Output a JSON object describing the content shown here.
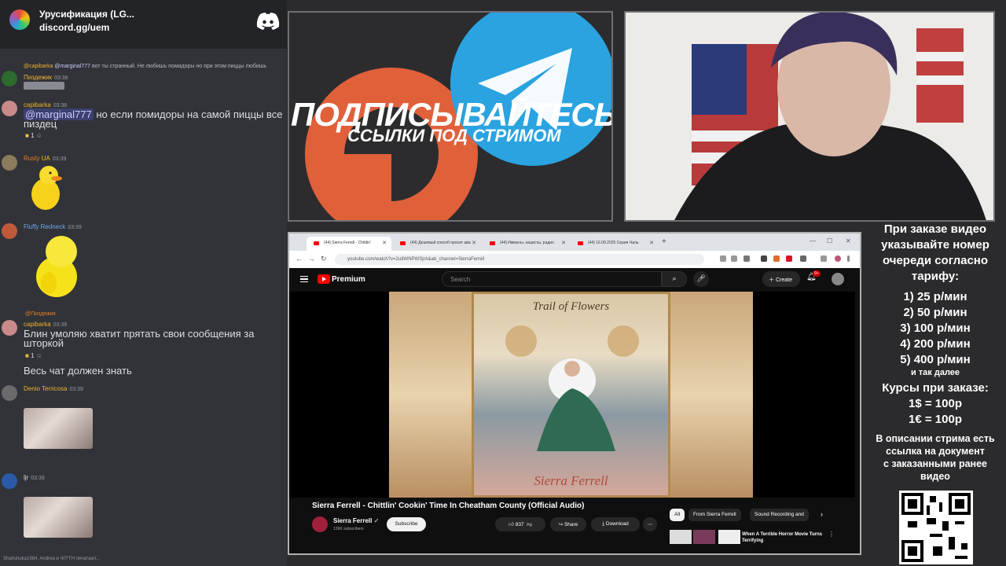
{
  "discord": {
    "server_name": "Урусификация (LG...",
    "server_link": "discord.gg/uem",
    "messages": [
      {
        "reply_author": "@capibarka",
        "reply_mention": "@marginal777",
        "reply_text": "вот ты странный. Не любишь помидоры но при этом пиццы любишь",
        "author": "Пиздежик",
        "time": "03:38"
      },
      {
        "author": "capibarka",
        "time": "03:38",
        "mention": "@marginal777",
        "text_rest": "но если помидоры на самой пиццы все",
        "text_line2": "пиздец",
        "reaction_count": "1"
      },
      {
        "author": "Rusty",
        "badges": "UA",
        "time": "03:39"
      },
      {
        "author": "Fluffy Redneck",
        "time": "03:39"
      },
      {
        "reply_author": "@Пиздежик",
        "author": "capibarka",
        "time": "03:39",
        "text_line1": "Блин умоляю хватит прятать свои сообщения за",
        "text_line2": "шторкой",
        "reaction_count": "1",
        "text2": "Весь чат должен знать"
      },
      {
        "author": "Denio Terricosa",
        "time": "03:39"
      },
      {
        "author": "ljr",
        "time": "03:39"
      }
    ],
    "typing": "Shahshuka1984, Andrea и ЧП*ТН печатают..."
  },
  "banner": {
    "line1": "ПОДПИСЫВАЙТЕСЬ",
    "line2": "ССЫЛКИ ПОД СТРИМОМ"
  },
  "browser": {
    "tabs": [
      {
        "label": "(44) Sierra Ferrell - Chittlin'"
      },
      {
        "label": "(44) Дешевый способ просит ава"
      },
      {
        "label": "(44) Иммуны, нацисты, радио"
      },
      {
        "label": "(44) 16.09.2025 Серия Чаль"
      }
    ],
    "url": "youtube.com/watch?v=2u8WNPWSjrA&ab_channel=SierraFerrell",
    "youtube": {
      "brand": "Premium",
      "search_placeholder": "Search",
      "create_label": "Create",
      "notif_count": "9+",
      "art_title": "Trail of Flowers",
      "art_name": "Sierra Ferrell",
      "video_title": "Sierra Ferrell - Chittlin' Cookin' Time In Cheatham County (Official Audio)",
      "channel_name": "Sierra Ferrell",
      "subscribers": "139K subscribers",
      "subscribe_label": "Subscribe",
      "like_count": "837",
      "share_label": "Share",
      "download_label": "Download",
      "chips": [
        "All",
        "From Sierra Ferrell",
        "Sound Recording and"
      ],
      "rec_title": "When A Terrible Horror Movie Turns Terrifying"
    }
  },
  "info_panel": {
    "heading": [
      "При заказе видео",
      "указывайте номер",
      "очереди согласно",
      "тарифу:"
    ],
    "tariffs": [
      "1) 25 р/мин",
      "2) 50 р/мин",
      "3) 100 р/мин",
      "4) 200 р/мин",
      "5) 400 р/мин"
    ],
    "etc": "и так далее",
    "rates_heading": "Курсы при заказе:",
    "rates": [
      "1$ = 100р",
      "1€ = 100р"
    ],
    "desc": [
      "В описании стрима есть",
      "ссылка на документ",
      "с заказанными ранее",
      "видео"
    ]
  },
  "colors": {
    "discord_bg": "#313338",
    "username_gold": "#f0b232",
    "username_orange": "#e67e22",
    "telegram_blue": "#2aa3e0",
    "boosty_orange": "#e0603a",
    "youtube_red": "#ff0000"
  }
}
